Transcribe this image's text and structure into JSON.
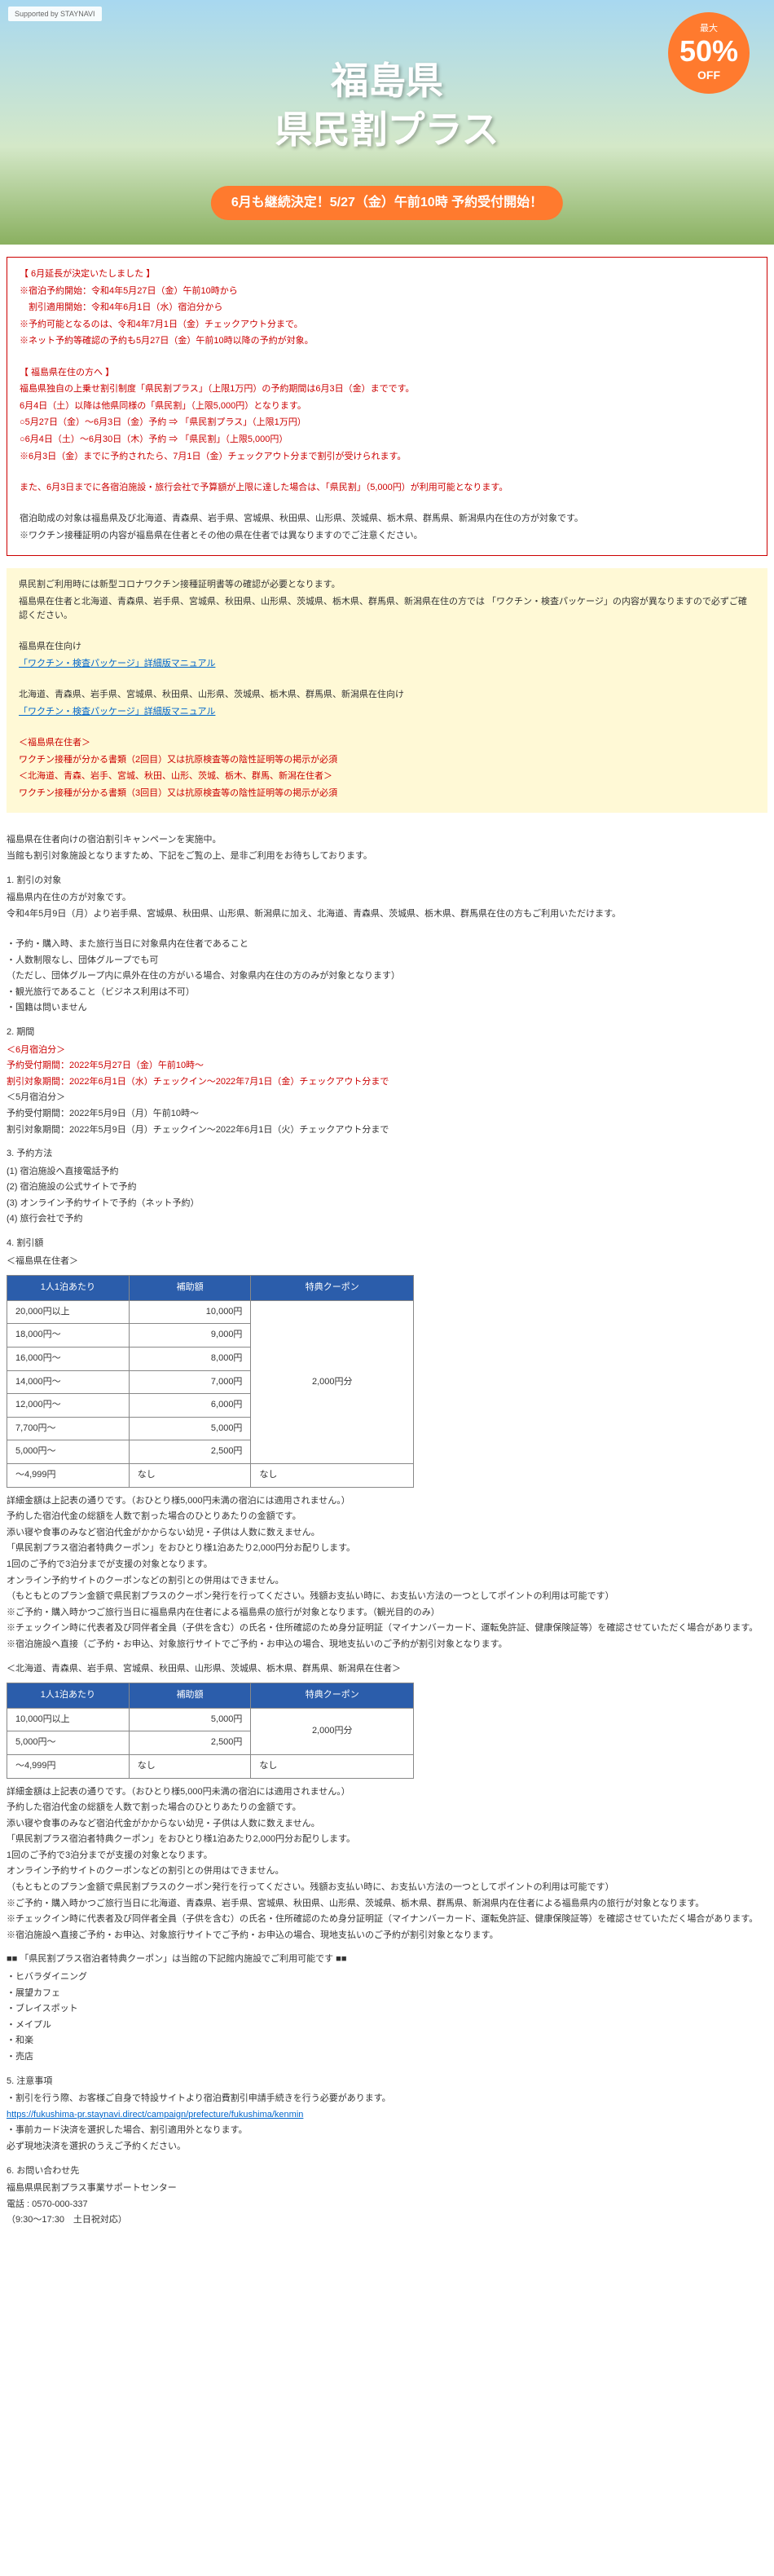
{
  "banner": {
    "staynavi": "Supported by STAYNAVI",
    "badge_max": "最大",
    "badge_pct": "50%",
    "badge_off": "OFF",
    "title_l1": "福島県",
    "title_l2": "県民割プラス",
    "subtitle": "6月も継続決定！5/27（金）午前10時 予約受付開始！"
  },
  "notice": {
    "h1": "【 6月延長が決定いたしました 】",
    "l1": "※宿泊予約開始：令和4年5月27日（金）午前10時から",
    "l2": "　割引適用開始：令和4年6月1日（水）宿泊分から",
    "l3": "※予約可能となるのは、令和4年7月1日（金）チェックアウト分まで。",
    "l4": "※ネット予約等確認の予約も5月27日（金）午前10時以降の予約が対象。",
    "h2": "【 福島県在住の方へ 】",
    "l5": "福島県独自の上乗せ割引制度「県民割プラス」（上限1万円）の予約期間は6月3日（金）までです。",
    "l6": "6月4日（土）以降は他県同様の「県民割」（上限5,000円）となります。",
    "l7": "○5月27日（金）～6月3日（金）予約 ⇒ 「県民割プラス」（上限1万円）",
    "l8": "○6月4日（土）～6月30日（木）予約 ⇒ 「県民割」（上限5,000円）",
    "l9": "※6月3日（金）までに予約されたら、7月1日（金）チェックアウト分まで割引が受けられます。",
    "l10": "また、6月3日までに各宿泊施設・旅行会社で予算額が上限に達した場合は、「県民割」（5,000円）が利用可能となります。",
    "l11": "宿泊助成の対象は福島県及び北海道、青森県、岩手県、宮城県、秋田県、山形県、茨城県、栃木県、群馬県、新潟県内在住の方が対象です。",
    "l12": "※ワクチン接種証明の内容が福島県在住者とその他の県在住者では異なりますのでご注意ください。"
  },
  "yellow": {
    "l1": "県民割ご利用時には新型コロナワクチン接種証明書等の確認が必要となります。",
    "l2": "福島県在住者と北海道、青森県、岩手県、宮城県、秋田県、山形県、茨城県、栃木県、群馬県、新潟県在住の方では 「ワクチン・検査パッケージ」の内容が異なりますので必ずご確認ください。",
    "l3": "福島県在住向け",
    "link1": "「ワクチン・検査パッケージ」詳細版マニュアル",
    "l4": "北海道、青森県、岩手県、宮城県、秋田県、山形県、茨城県、栃木県、群馬県、新潟県在住向け",
    "link2": "「ワクチン・検査パッケージ」詳細版マニュアル",
    "r1": "＜福島県在住者＞",
    "r2": "ワクチン接種が分かる書類（2回目）又は抗原検査等の陰性証明等の掲示が必須",
    "r3": "＜北海道、青森、岩手、宮城、秋田、山形、茨城、栃木、群馬、新潟在住者＞",
    "r4": "ワクチン接種が分かる書類（3回目）又は抗原検査等の陰性証明等の掲示が必須"
  },
  "content": {
    "intro1": "福島県在住者向けの宿泊割引キャンペーンを実施中。",
    "intro2": "当館も割引対象施設となりますため、下記をご覧の上、是非ご利用をお待ちしております。",
    "s1h": "1. 割引の対象",
    "s1_1": "福島県内在住の方が対象です。",
    "s1_2": "令和4年5月9日（月）より岩手県、宮城県、秋田県、山形県、新潟県に加え、北海道、青森県、茨城県、栃木県、群馬県在住の方もご利用いただけます。",
    "s1_3": "・予約・購入時、また旅行当日に対象県内在住者であること",
    "s1_4": "・人数制限なし、団体グループでも可",
    "s1_5": "（ただし、団体グループ内に県外在住の方がいる場合、対象県内在住の方のみが対象となります）",
    "s1_6": "・観光旅行であること（ビジネス利用は不可）",
    "s1_7": "・国籍は問いません",
    "s2h": "2. 期間",
    "s2_1": "＜6月宿泊分＞",
    "s2_2": "予約受付期間：2022年5月27日（金）午前10時～",
    "s2_3": "割引対象期間：2022年6月1日（水）チェックイン～2022年7月1日（金）チェックアウト分まで",
    "s2_4": "＜5月宿泊分＞",
    "s2_5": "予約受付期間：2022年5月9日（月）午前10時～",
    "s2_6": "割引対象期間：2022年5月9日（月）チェックイン～2022年6月1日（火）チェックアウト分まで",
    "s3h": "3. 予約方法",
    "s3_1": "(1) 宿泊施設へ直接電話予約",
    "s3_2": "(2) 宿泊施設の公式サイトで予約",
    "s3_3": "(3) オンライン予約サイトで予約（ネット予約）",
    "s3_4": "(4) 旅行会社で予約",
    "s4h": "4. 割引額",
    "s4_sub1": "＜福島県在住者＞",
    "th1": "1人1泊あたり",
    "th2": "補助額",
    "th3": "特典クーポン",
    "t1": {
      "rows": [
        [
          "20,000円以上",
          "10,000円"
        ],
        [
          "18,000円～",
          "9,000円"
        ],
        [
          "16,000円～",
          "8,000円"
        ],
        [
          "14,000円～",
          "7,000円"
        ],
        [
          "12,000円～",
          "6,000円"
        ],
        [
          "7,700円～",
          "5,000円"
        ],
        [
          "5,000円～",
          "2,500円"
        ]
      ],
      "coupon": "2,000円分",
      "last": [
        "～4,999円",
        "なし",
        "なし"
      ]
    },
    "p1_1": "詳細金額は上記表の通りです。（おひとり様5,000円未満の宿泊には適用されません。）",
    "p1_2": "予約した宿泊代金の総額を人数で割った場合のひとりあたりの金額です。",
    "p1_3": "添い寝や食事のみなど宿泊代金がかからない幼児・子供は人数に数えません。",
    "p1_4": "「県民割プラス宿泊者特典クーポン」をおひとり様1泊あたり2,000円分お配りします。",
    "p1_5": "1回のご予約で3泊分までが支援の対象となります。",
    "p1_6": "オンライン予約サイトのクーポンなどの割引との併用はできません。",
    "p1_7": "（もともとのプラン金額で県民割プラスのクーポン発行を行ってください。残額お支払い時に、お支払い方法の一つとしてポイントの利用は可能です）",
    "p1_8": "※ご予約・購入時かつご旅行当日に福島県内在住者による福島県の旅行が対象となります。（観光目的のみ）",
    "p1_9": "※チェックイン時に代表者及び同伴者全員（子供を含む）の氏名・住所確認のため身分証明証（マイナンバーカード、運転免許証、健康保険証等）を確認させていただく場合があります。",
    "p1_10": "※宿泊施設へ直接（ご予約・お申込、対象旅行サイトでご予約・お申込の場合、現地支払いのご予約が割引対象となります。",
    "s4_sub2": "＜北海道、青森県、岩手県、宮城県、秋田県、山形県、茨城県、栃木県、群馬県、新潟県在住者＞",
    "t2": {
      "rows": [
        [
          "10,000円以上",
          "5,000円"
        ],
        [
          "5,000円～",
          "2,500円"
        ]
      ],
      "coupon": "2,000円分",
      "last": [
        "～4,999円",
        "なし",
        "なし"
      ]
    },
    "p2_1": "詳細金額は上記表の通りです。（おひとり様5,000円未満の宿泊には適用されません。）",
    "p2_2": "予約した宿泊代金の総額を人数で割った場合のひとりあたりの金額です。",
    "p2_3": "添い寝や食事のみなど宿泊代金がかからない幼児・子供は人数に数えません。",
    "p2_4": "「県民割プラス宿泊者特典クーポン」をおひとり様1泊あたり2,000円分お配りします。",
    "p2_5": "1回のご予約で3泊分までが支援の対象となります。",
    "p2_6": "オンライン予約サイトのクーポンなどの割引との併用はできません。",
    "p2_7": "（もともとのプラン金額で県民割プラスのクーポン発行を行ってください。残額お支払い時に、お支払い方法の一つとしてポイントの利用は可能です）",
    "p2_8": "※ご予約・購入時かつご旅行当日に北海道、青森県、岩手県、宮城県、秋田県、山形県、茨城県、栃木県、群馬県、新潟県内在住者による福島県内の旅行が対象となります。",
    "p2_9": "※チェックイン時に代表者及び同伴者全員（子供を含む）の氏名・住所確認のため身分証明証（マイナンバーカード、運転免許証、健康保険証等）を確認させていただく場合があります。",
    "p2_10": "※宿泊施設へ直接ご予約・お申込、対象旅行サイトでご予約・お申込の場合、現地支払いのご予約が割引対象となります。",
    "coupon_h": "■■ 「県民割プラス宿泊者特典クーポン」は当館の下記館内施設でご利用可能です ■■",
    "fac": [
      "・ヒバラダイニング",
      "・展望カフェ",
      "・ブレイスポット",
      "・メイプル",
      "・和楽",
      "・売店"
    ],
    "s5h": "5. 注意事項",
    "s5_1": "・割引を行う際、お客様ご自身で特設サイトより宿泊費割引申請手続きを行う必要があります。",
    "s5_link": "https://fukushima-pr.staynavi.direct/campaign/prefecture/fukushima/kenmin",
    "s5_2": "・事前カード決済を選択した場合、割引適用外となります。",
    "s5_3": "必ず現地決済を選択のうえご予約ください。",
    "s6h": "6. お問い合わせ先",
    "s6_1": "福島県県民割プラス事業サポートセンター",
    "s6_2": "電話 : 0570-000-337",
    "s6_3": "（9:30～17:30　土日祝対応）"
  }
}
